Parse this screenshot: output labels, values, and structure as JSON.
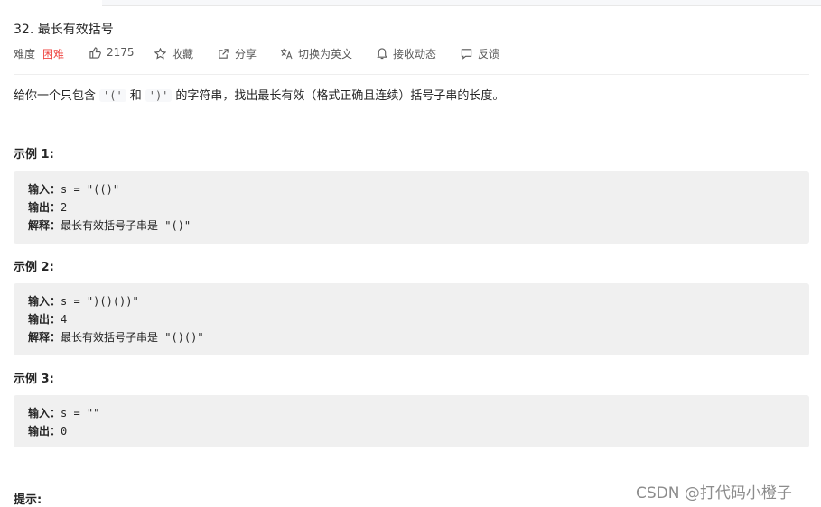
{
  "problem": {
    "title": "32. 最长有效括号",
    "difficulty_label": "难度",
    "difficulty_value": "困难",
    "likes": "2175",
    "collect": "收藏",
    "share": "分享",
    "switch_lang": "切换为英文",
    "notify": "接收动态",
    "feedback": "反馈"
  },
  "description": {
    "before": "给你一个只包含",
    "code1": "'('",
    "and": "和",
    "code2": "')'",
    "after": "的字符串，找出最长有效（格式正确且连续）括号子串的长度。"
  },
  "examples": [
    {
      "heading": "示例 1:",
      "input_key": "输入：",
      "input_val": "s = \"(()\"",
      "output_key": "输出：",
      "output_val": "2",
      "explain_key": "解释：",
      "explain_val": "最长有效括号子串是 \"()\""
    },
    {
      "heading": "示例 2:",
      "input_key": "输入：",
      "input_val": "s = \")()())\"",
      "output_key": "输出：",
      "output_val": "4",
      "explain_key": "解释：",
      "explain_val": "最长有效括号子串是 \"()()\""
    },
    {
      "heading": "示例 3:",
      "input_key": "输入：",
      "input_val": "s = \"\"",
      "output_key": "输出：",
      "output_val": "0"
    }
  ],
  "hint_heading": "提示:",
  "watermark": "CSDN @打代码小橙子",
  "colors": {
    "difficulty_hard": "#ef4743",
    "code_bg": "#f0f0f0"
  }
}
